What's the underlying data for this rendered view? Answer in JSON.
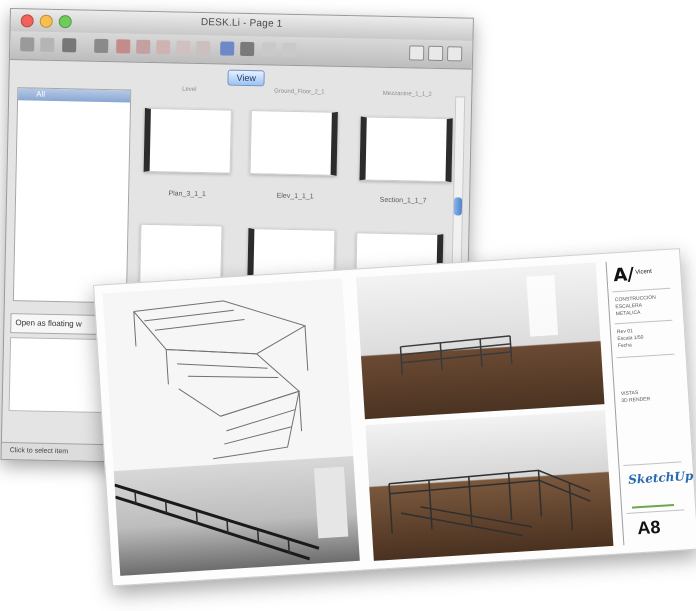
{
  "window": {
    "title": "DESK.Li - Page 1",
    "view_button": "View",
    "sidebar_header": "All",
    "columns": [
      "Level",
      "Ground_Floor_2_1",
      "Mezzanine_1_1_2"
    ],
    "thumbnail_labels": [
      "Plan_3_1_1",
      "Elev_1_1_1",
      "Section_1_1_7"
    ],
    "open_button": "Open as floating w",
    "status": "Click to select item"
  },
  "sheet": {
    "logo": "A/",
    "logo_word": "Vicent",
    "project_lines": [
      "CONSTRUCCION",
      "ESCALERA",
      "METALICA"
    ],
    "info_lines": [
      "Rev 01",
      "Escala 1/50",
      "Fecha"
    ],
    "notes": [
      "VISTAS",
      "3D RENDER"
    ],
    "brand": "SketchUp",
    "code": "A8"
  },
  "colors": {
    "accent": "#4d82cc",
    "brand": "#2a6ab0"
  }
}
